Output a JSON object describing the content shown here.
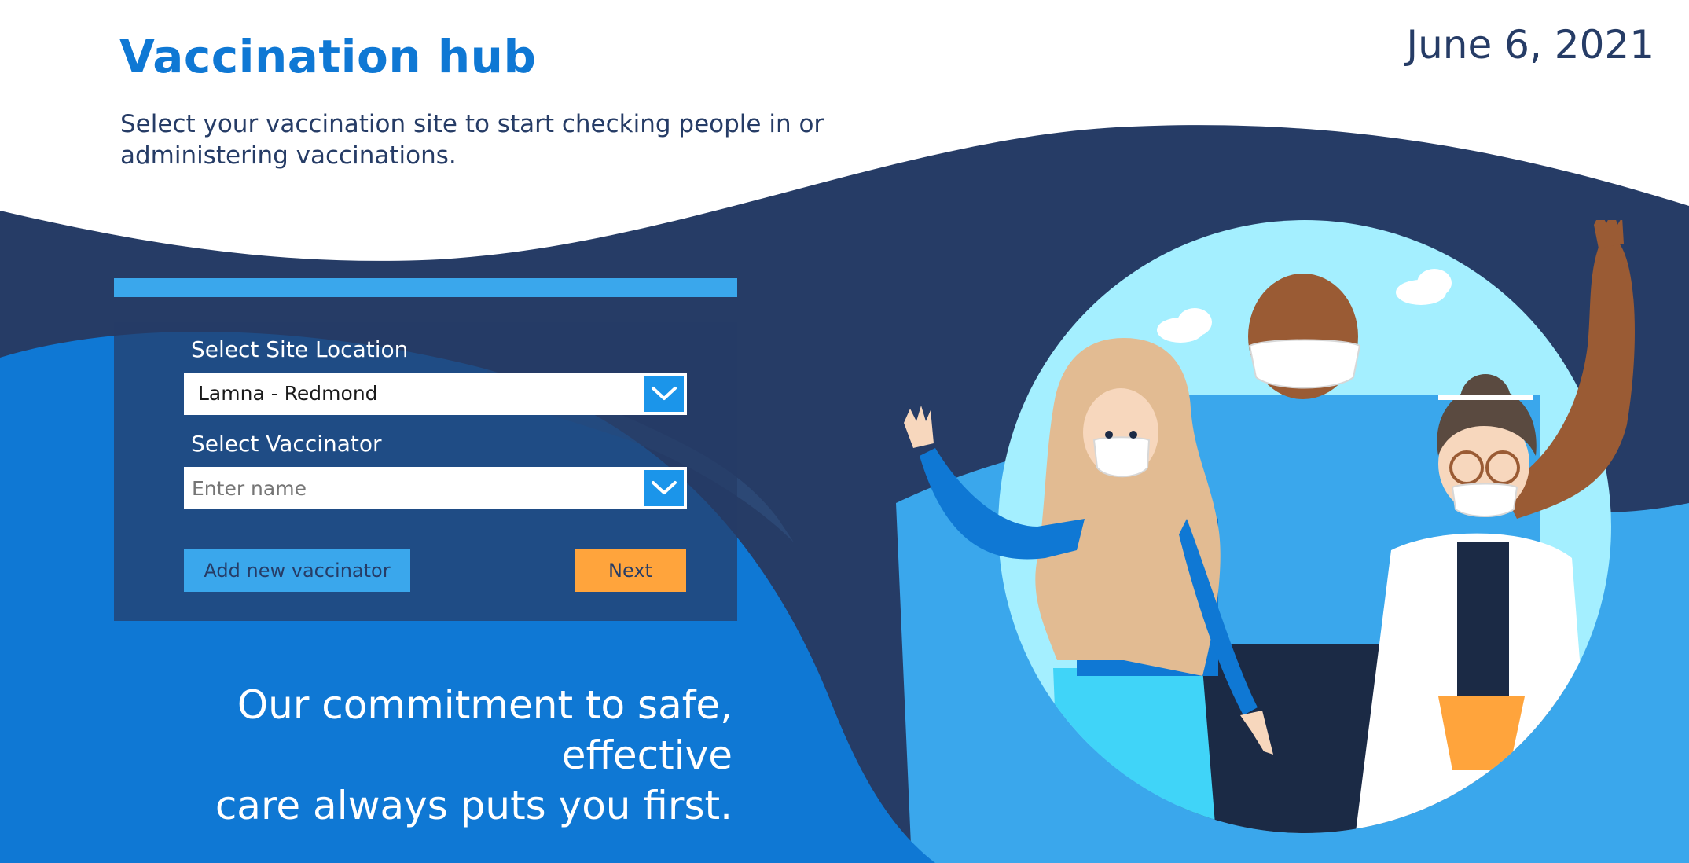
{
  "header": {
    "title": "Vaccination hub",
    "date": "June 6, 2021",
    "subtitle": "Select your vaccination site to start checking people in or administering vaccinations."
  },
  "form": {
    "site_label": "Select Site Location",
    "site_value": "Lamna - Redmond",
    "vaccinator_label": "Select Vaccinator",
    "vaccinator_placeholder": "Enter name",
    "add_button": "Add new vaccinator",
    "next_button": "Next"
  },
  "footer": {
    "tagline_line1": "Our commitment to safe, effective",
    "tagline_line2": "care always puts you first."
  },
  "colors": {
    "brand_blue": "#0f78d4",
    "navy": "#263c66",
    "sky_blue": "#3aa7ec",
    "accent_orange": "#ffa43c"
  },
  "icons": [
    "chevron-down-icon",
    "illustration-people-masks"
  ]
}
